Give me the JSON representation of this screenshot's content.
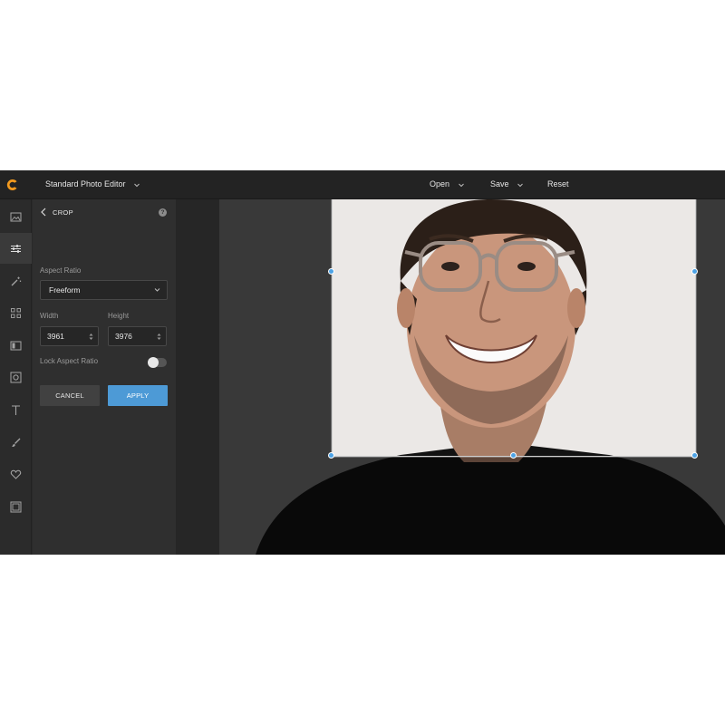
{
  "topbar": {
    "editor_title": "Standard Photo Editor",
    "open_label": "Open",
    "save_label": "Save",
    "reset_label": "Reset"
  },
  "rail": {
    "items": [
      {
        "icon": "image-icon"
      },
      {
        "icon": "adjust-sliders-icon"
      },
      {
        "icon": "magic-wand-icon"
      },
      {
        "icon": "grid-icon"
      },
      {
        "icon": "layout-icon"
      },
      {
        "icon": "frame-icon"
      },
      {
        "icon": "text-icon"
      },
      {
        "icon": "brush-icon"
      },
      {
        "icon": "heart-icon"
      },
      {
        "icon": "overlay-icon"
      }
    ],
    "active_index": 1
  },
  "panel": {
    "title": "CROP",
    "help_label": "?",
    "aspect_ratio_label": "Aspect Ratio",
    "aspect_ratio_value": "Freeform",
    "width_label": "Width",
    "width_value": "3961",
    "height_label": "Height",
    "height_value": "3976",
    "lock_label": "Lock Aspect Ratio",
    "lock_on": false,
    "cancel_label": "CANCEL",
    "apply_label": "APPLY"
  },
  "colors": {
    "accent": "#4d9ad6",
    "handle": "#4da3e6",
    "logo": "#f39a1e"
  }
}
